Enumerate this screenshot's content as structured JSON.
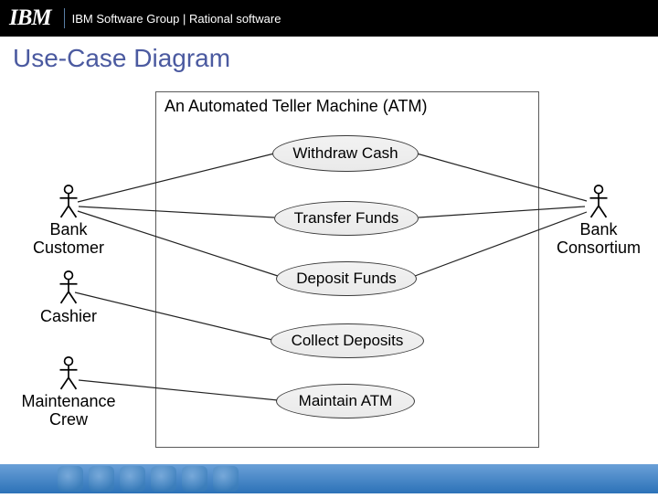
{
  "header": {
    "logo_text": "IBM",
    "group_text": "IBM Software Group | Rational software"
  },
  "title": "Use-Case Diagram",
  "system": {
    "name": "An Automated Teller Machine (ATM)"
  },
  "usecases": {
    "withdraw": "Withdraw Cash",
    "transfer": "Transfer Funds",
    "deposit": "Deposit Funds",
    "collect": "Collect Deposits",
    "maintain": "Maintain ATM"
  },
  "actors": {
    "bank_customer": "Bank Customer",
    "cashier": "Cashier",
    "maintenance_crew": "Maintenance Crew",
    "bank_consortium": "Bank Consortium"
  },
  "associations": [
    [
      "bank_customer",
      "withdraw"
    ],
    [
      "bank_customer",
      "transfer"
    ],
    [
      "bank_customer",
      "deposit"
    ],
    [
      "cashier",
      "collect"
    ],
    [
      "maintenance_crew",
      "maintain"
    ],
    [
      "bank_consortium",
      "withdraw"
    ],
    [
      "bank_consortium",
      "transfer"
    ],
    [
      "bank_consortium",
      "deposit"
    ]
  ]
}
